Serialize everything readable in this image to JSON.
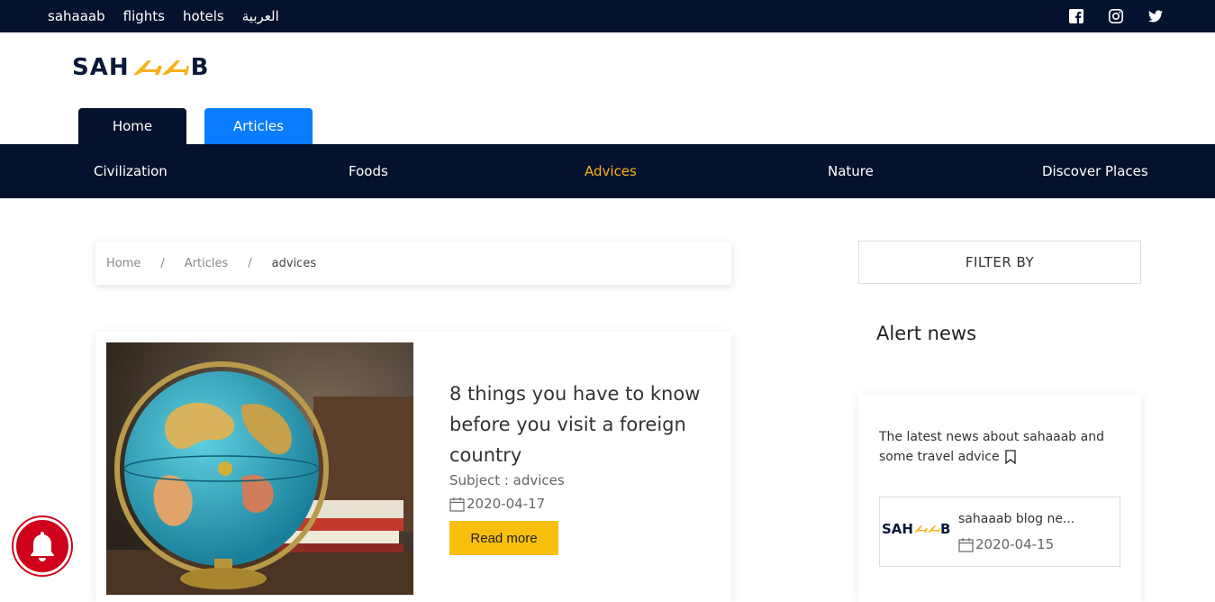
{
  "topbar": {
    "links": [
      "sahaaab",
      "flights",
      "hotels",
      "العربية"
    ],
    "social_icons": [
      "facebook-icon",
      "instagram-icon",
      "twitter-icon"
    ]
  },
  "logo": {
    "left": "SAH",
    "right": "B"
  },
  "tabs": {
    "home": "Home",
    "articles": "Articles"
  },
  "categories": [
    {
      "label": "Civilization",
      "active": false
    },
    {
      "label": "Foods",
      "active": false
    },
    {
      "label": "Advices",
      "active": true
    },
    {
      "label": "Nature",
      "active": false
    },
    {
      "label": "Discover Places",
      "active": false
    }
  ],
  "breadcrumb": {
    "home": "Home",
    "sep": "/",
    "articles": "Articles",
    "current": "advices"
  },
  "article": {
    "title": "8 things you have to know before you visit a foreign country",
    "subject": "Subject : advices",
    "date": "2020-04-17",
    "button": "Read more"
  },
  "sidebar": {
    "filter": "FILTER BY",
    "alert_title": "Alert news",
    "alert_desc": "The latest news about sahaaab and some travel advice",
    "news_item": {
      "logo_left": "SAH",
      "logo_right": "B",
      "title": "sahaaab blog ne...",
      "date": "2020-04-15"
    }
  },
  "colors": {
    "navy": "#05122e",
    "blue": "#0a7cff",
    "accent": "#f5b21b",
    "button": "#f9bf0f",
    "bell": "#d0021b"
  }
}
